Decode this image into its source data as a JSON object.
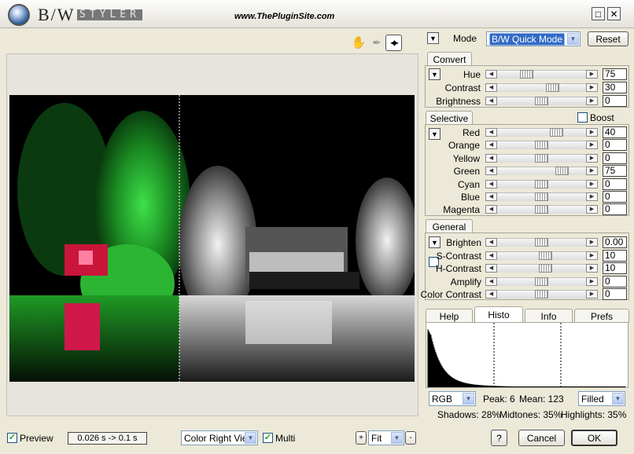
{
  "app": {
    "name": "B/W",
    "styler": "STYLER",
    "site": "www.ThePluginSite.com"
  },
  "window": {
    "maximize_glyph": "□",
    "close_glyph": "✕"
  },
  "tools": {
    "hand": "✋",
    "picker": "✒",
    "split": "◀|▶"
  },
  "mode": {
    "label": "Mode",
    "value": "B/W Quick Mode",
    "reset": "Reset"
  },
  "convert": {
    "tab": "Convert",
    "rows": [
      {
        "label": "Hue",
        "value": "75",
        "pos": 0.3
      },
      {
        "label": "Contrast",
        "value": "30",
        "pos": 0.65
      },
      {
        "label": "Brightness",
        "value": "0",
        "pos": 0.5
      }
    ]
  },
  "selective": {
    "tab": "Selective",
    "boost": "Boost",
    "rows": [
      {
        "label": "Red",
        "value": "40",
        "pos": 0.7
      },
      {
        "label": "Orange",
        "value": "0",
        "pos": 0.5
      },
      {
        "label": "Yellow",
        "value": "0",
        "pos": 0.5
      },
      {
        "label": "Green",
        "value": "75",
        "pos": 0.77
      },
      {
        "label": "Cyan",
        "value": "0",
        "pos": 0.5
      },
      {
        "label": "Blue",
        "value": "0",
        "pos": 0.5
      },
      {
        "label": "Magenta",
        "value": "0",
        "pos": 0.5
      }
    ]
  },
  "general": {
    "tab": "General",
    "rows": [
      {
        "label": "Brighten",
        "value": "0.00",
        "pos": 0.5
      },
      {
        "label": "S-Contrast",
        "value": "10",
        "pos": 0.55
      },
      {
        "label": "H-Contrast",
        "value": "10",
        "pos": 0.55
      },
      {
        "label": "Amplify",
        "value": "0",
        "pos": 0.5
      },
      {
        "label": "Color Contrast",
        "value": "0",
        "pos": 0.5
      }
    ]
  },
  "tabs": {
    "help": "Help",
    "histo": "Histo",
    "info": "Info",
    "prefs": "Prefs"
  },
  "histo": {
    "channel": "RGB",
    "peak": "Peak: 6",
    "mean": "Mean: 123",
    "fill": "Filled",
    "shadows": "Shadows: 28%",
    "midtones": "Midtones: 35%",
    "highlights": "Highlights: 35%"
  },
  "bottom": {
    "preview": "Preview",
    "time": "0.026 s -> 0.1 s",
    "view": "Color Right View",
    "multi": "Multi",
    "zoom_plus": "+",
    "zoom": "Fit",
    "zoom_minus": "-",
    "help": "?",
    "cancel": "Cancel",
    "ok": "OK"
  },
  "arrows": {
    "left": "◀",
    "right": "▶",
    "down": "▼"
  }
}
